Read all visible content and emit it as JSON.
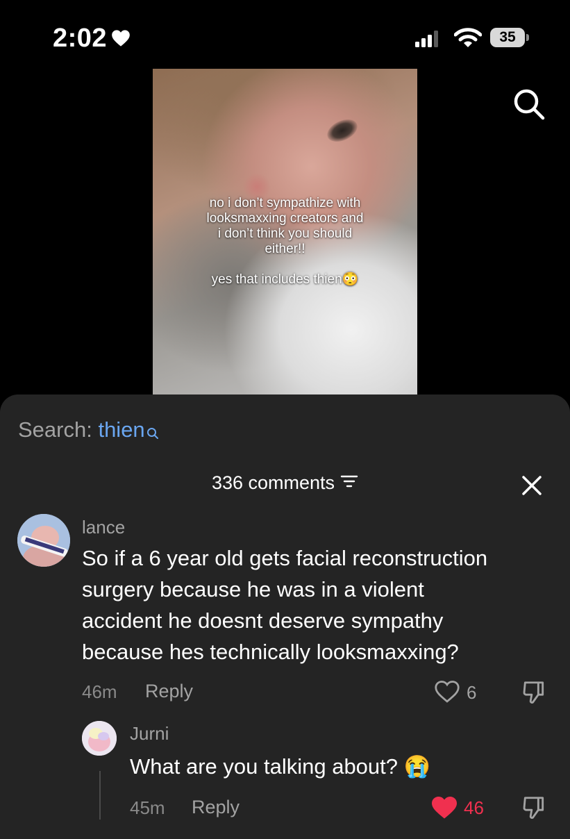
{
  "status_bar": {
    "time": "2:02",
    "battery": "35",
    "icons": [
      "heart-icon",
      "cellular-signal-icon",
      "wifi-icon",
      "battery-icon"
    ]
  },
  "video": {
    "caption_lines": [
      "no i don’t sympathize with",
      "looksmaxxing creators and",
      "i don’t think you should",
      "either!!"
    ],
    "caption_line2": "yes that includes thien😳"
  },
  "search": {
    "label": "Search: ",
    "keyword": "thien"
  },
  "comments": {
    "count_label": "336 comments",
    "items": [
      {
        "user": "lance",
        "text_lines": [
          "So if a 6 year old gets facial reconstruction",
          "surgery because he was in a violent",
          "accident he doesnt deserve sympathy",
          "because hes technically looksmaxxing?"
        ],
        "time": "46m",
        "reply_label": "Reply",
        "likes": "6",
        "liked": false
      },
      {
        "user": "Jurni",
        "text": "What are you talking about? 😭",
        "time": "45m",
        "reply_label": "Reply",
        "likes": "46",
        "liked": true
      }
    ]
  },
  "colors": {
    "sheet_bg": "#242424",
    "search_keyword": "#6aa6f0",
    "liked_heart": "#f0304f",
    "muted_text": "#a3a3a3"
  }
}
